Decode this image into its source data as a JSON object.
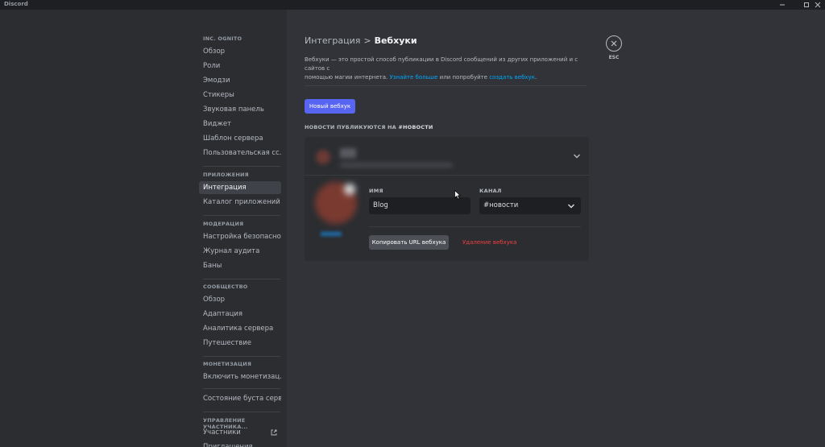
{
  "window": {
    "app_name": "Discord"
  },
  "sidebar": {
    "sections": [
      {
        "header": "INC. OGNITO",
        "items": [
          "Обзор",
          "Роли",
          "Эмодзи",
          "Стикеры",
          "Звуковая панель",
          "Виджет",
          "Шаблон сервера",
          "Пользовательская сс..."
        ]
      },
      {
        "header": "ПРИЛОЖЕНИЯ",
        "items": [
          "Интеграция",
          "Каталог приложений"
        ]
      },
      {
        "header": "МОДЕРАЦИЯ",
        "items": [
          "Настройка безопасно...",
          "Журнал аудита",
          "Баны"
        ]
      },
      {
        "header": "СООБЩЕСТВО",
        "items": [
          "Обзор",
          "Адаптация",
          "Аналитика сервера",
          "Путешествие"
        ]
      },
      {
        "header": "МОНЕТИЗАЦИЯ",
        "items": [
          "Включить монетизац..."
        ]
      },
      {
        "header": "",
        "items": [
          "Состояние буста сервера"
        ]
      },
      {
        "header": "УПРАВЛЕНИЕ УЧАСТНИКА...",
        "items": [
          "Участники",
          "Приглашения"
        ]
      }
    ],
    "active_item": "Интеграция"
  },
  "main": {
    "breadcrumb_parent": "Интеграция",
    "breadcrumb_sep": ">",
    "breadcrumb_current": "Вебхуки",
    "description_line1": "Вебхуки — это простой способ публикации в Discord сообщений из других приложений и с сайтов с",
    "description_line2_prefix": "помощью магии интернета. ",
    "description_link1": "Узнайте больше",
    "description_mid": " или попробуйте ",
    "description_link2": "создать вебхук",
    "description_end": ".",
    "new_webhook_button": "Новый вебхук",
    "section_label_prefix": "НОВОСТИ ПУБЛИКУЮТСЯ НА ",
    "section_label_channel": "#НОВОСТИ",
    "webhook": {
      "name_label": "ИМЯ",
      "name_value": "Blog",
      "channel_label": "КАНАЛ",
      "channel_value": "#новости",
      "copy_url_button": "Копировать URL вебхука",
      "delete_button": "Удаление вебхука"
    },
    "esc_label": "ESC"
  },
  "colors": {
    "accent": "#5865f2",
    "danger": "#f23f43",
    "link": "#00a8fc",
    "background": "#313338",
    "sidebar": "#2b2d31"
  }
}
